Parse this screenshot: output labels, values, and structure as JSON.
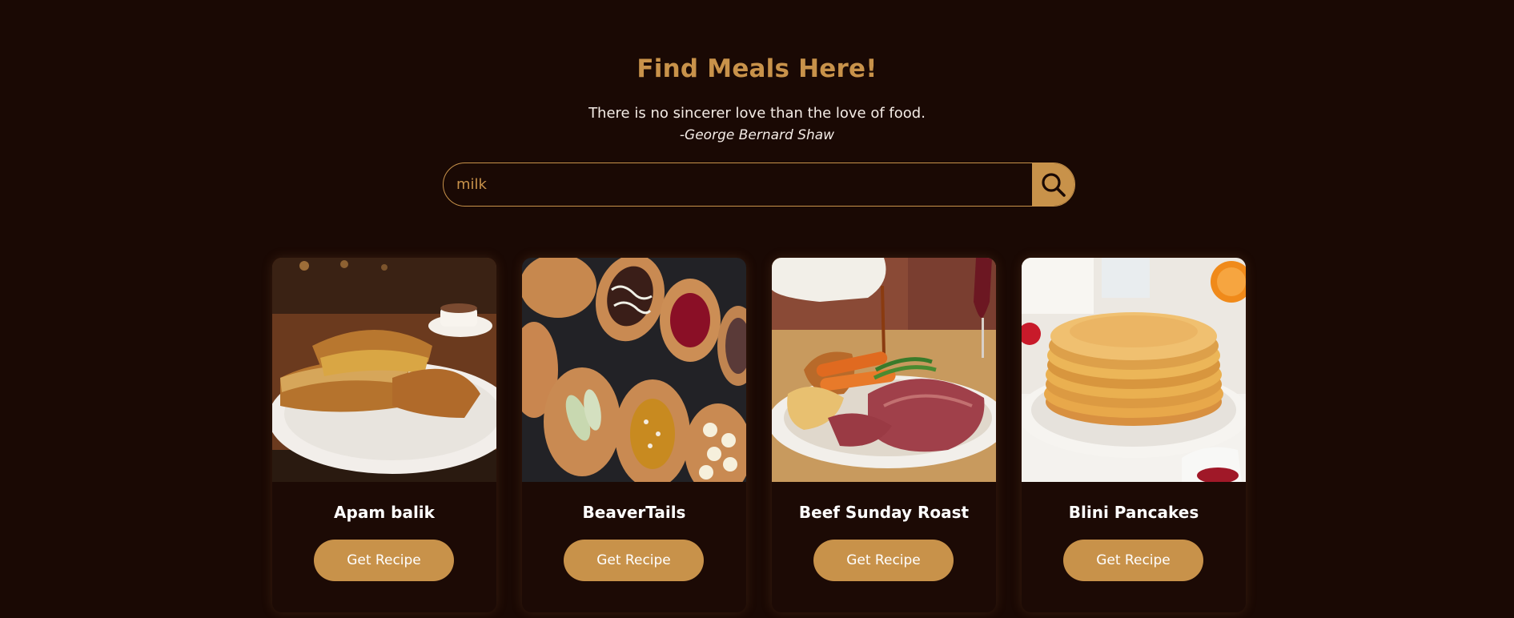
{
  "header": {
    "title": "Find Meals Here!",
    "quote": "There is no sincerer love than the love of food.",
    "author": "-George Bernard Shaw"
  },
  "search": {
    "value": "milk",
    "button_icon": "search-icon"
  },
  "colors": {
    "background": "#1a0904",
    "accent": "#c8924a",
    "text": "#ffffff"
  },
  "meals": [
    {
      "name": "Apam balik",
      "button_label": "Get Recipe",
      "image": "apam-balik-photo"
    },
    {
      "name": "BeaverTails",
      "button_label": "Get Recipe",
      "image": "beavertails-photo"
    },
    {
      "name": "Beef Sunday Roast",
      "button_label": "Get Recipe",
      "image": "beef-sunday-roast-photo"
    },
    {
      "name": "Blini Pancakes",
      "button_label": "Get Recipe",
      "image": "blini-pancakes-photo"
    }
  ]
}
